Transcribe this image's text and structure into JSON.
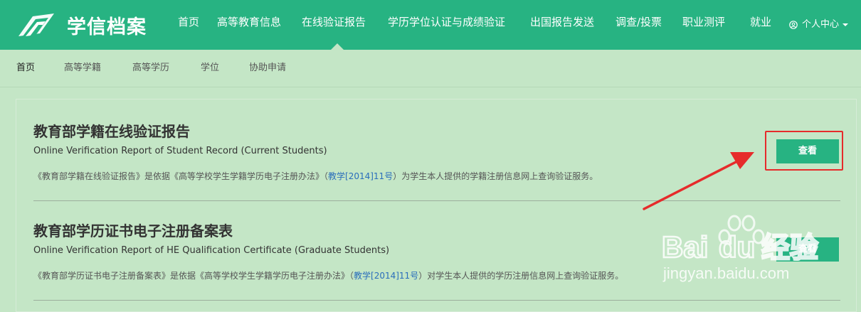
{
  "brand": {
    "name": "学信档案"
  },
  "topnav": {
    "items": [
      {
        "label": "首页"
      },
      {
        "label": "高等教育信息"
      },
      {
        "label": "在线验证报告"
      },
      {
        "label": "学历学位认证与成绩验证"
      },
      {
        "label": "出国报告发送"
      },
      {
        "label": "调查/投票"
      },
      {
        "label": "职业测评"
      },
      {
        "label": "就业"
      }
    ],
    "active": "在线验证报告",
    "user_center": "个人中心"
  },
  "subnav": {
    "items": [
      {
        "label": "首页"
      },
      {
        "label": "高等学籍"
      },
      {
        "label": "高等学历"
      },
      {
        "label": "学位"
      },
      {
        "label": "协助申请"
      }
    ]
  },
  "reports": [
    {
      "title": "教育部学籍在线验证报告",
      "subtitle": "Online Verification Report of Student Record (Current Students)",
      "desc_before": "《教育部学籍在线验证报告》是依据《高等学校学生学籍学历电子注册办法》（",
      "desc_link": "教学[2014]11号",
      "desc_after": "）为学生本人提供的学籍注册信息网上查询验证服务。",
      "button": "查看"
    },
    {
      "title": "教育部学历证书电子注册备案表",
      "subtitle": "Online Verification Report of HE Qualification Certificate (Graduate Students)",
      "desc_before": "《教育部学历证书电子注册备案表》是依据《高等学校学生学籍学历电子注册办法》（",
      "desc_link": "教学[2014]11号",
      "desc_after": "）对学生本人提供的学历注册信息网上查询验证服务。",
      "button": "查看"
    }
  ],
  "watermark": {
    "brand": "Bai",
    "brand_tail": "du",
    "brand_cn": "经验",
    "url": "jingyan.baidu.com"
  },
  "colors": {
    "brand_green": "#27b382",
    "page_bg": "#c4e6c6",
    "highlight_red": "#e62b2b",
    "link_blue": "#2a6ebb"
  }
}
